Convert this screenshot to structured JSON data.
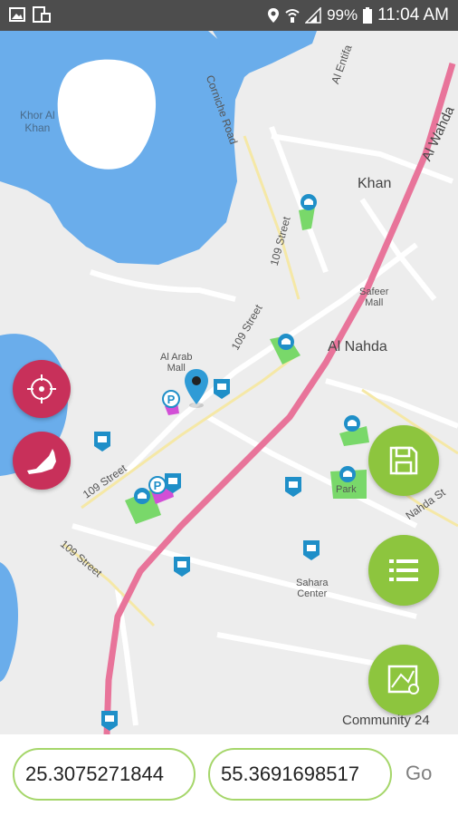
{
  "status_bar": {
    "battery": "99%",
    "time": "11:04 AM"
  },
  "map": {
    "labels": {
      "khor_al_khan": "Khor Al\nKhan",
      "corniche_road": "Corniche Road",
      "al_entifa": "Al Entifa",
      "al_wahda": "Al Wahda",
      "khan": "Khan",
      "street_109_a": "109 Street",
      "street_109_b": "109 Street",
      "street_109_c": "109 Street",
      "street_109_d": "109 Street",
      "safeer_mall": "Safeer\nMall",
      "al_nahda": "Al Nahda",
      "al_arab_mall": "Al Arab\nMall",
      "park": "Park",
      "nahda_street": "Nahda St",
      "sahara_center": "Sahara\nCenter",
      "community": "Community 24"
    },
    "colors": {
      "water": "#6aadeb",
      "road_main": "#e8749a",
      "land": "#ececec",
      "park": "#79d86a"
    }
  },
  "buttons": {
    "locate_icon": "crosshair-icon",
    "uae_icon": "uae-map-icon",
    "save_icon": "floppy-disk-icon",
    "list_icon": "list-icon",
    "map_icon": "map-pin-icon"
  },
  "coordinates": {
    "latitude": "25.3075271844",
    "longitude": "55.3691698517",
    "go_label": "Go"
  }
}
